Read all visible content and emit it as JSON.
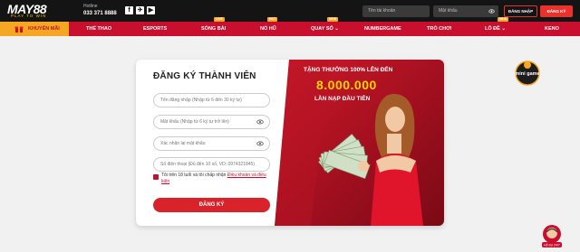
{
  "header": {
    "logo": "MAY88",
    "logo_tagline": "PLAY TO WIN",
    "hotline_label": "Hotline",
    "hotline_number": "033 371 8888",
    "username_placeholder": "Tên tài khoản",
    "password_placeholder": "Mật khẩu",
    "login_label": "ĐĂNG NHẬP",
    "register_label": "ĐĂNG KÝ"
  },
  "nav": {
    "promo": "KHUYẾN MÃI",
    "items": [
      {
        "label": "THỂ THAO"
      },
      {
        "label": "ESPORTS"
      },
      {
        "label": "SÒNG BÀI",
        "badge": "LIVE"
      },
      {
        "label": "NỔ HŨ",
        "badge": "HOT"
      },
      {
        "label": "QUAY SỐ ⌄",
        "badge": "NEW"
      },
      {
        "label": "NUMBERGAME"
      },
      {
        "label": "TRÒ CHƠI"
      },
      {
        "label": "LÔ ĐỀ ⌄",
        "badge": "NEW"
      },
      {
        "label": "KENO"
      }
    ]
  },
  "form": {
    "title": "ĐĂNG KÝ THÀNH VIÊN",
    "username_placeholder": "Tên đăng nhập (Nhập từ 6 đến 30 ký tự)",
    "password_placeholder": "Mật khẩu (Nhập từ 6 ký tự trở lên)",
    "confirm_placeholder": "Xác nhận lại mật khẩu",
    "phone_placeholder": "Số điện thoại (Đủ đến 10 số, VD: 0974321845)",
    "terms_text": "Tôi trên 18 tuổi và tôi chấp nhận",
    "terms_link": "Điều khoản và điều kiện",
    "submit_label": "ĐĂNG KÝ"
  },
  "banner": {
    "line1": "TẶNG THƯỞNG 100% LÊN ĐẾN",
    "amount": "8.000.000",
    "line3": "LẦN NẠP ĐẦU TIÊN"
  },
  "side_badge": {
    "label": "mini game"
  },
  "chat": {
    "label": "Hỗ trợ 24/7"
  },
  "colors": {
    "brand_red": "#c8102e",
    "gold": "#ffd400",
    "orange": "#f5a623",
    "dark": "#141414"
  }
}
